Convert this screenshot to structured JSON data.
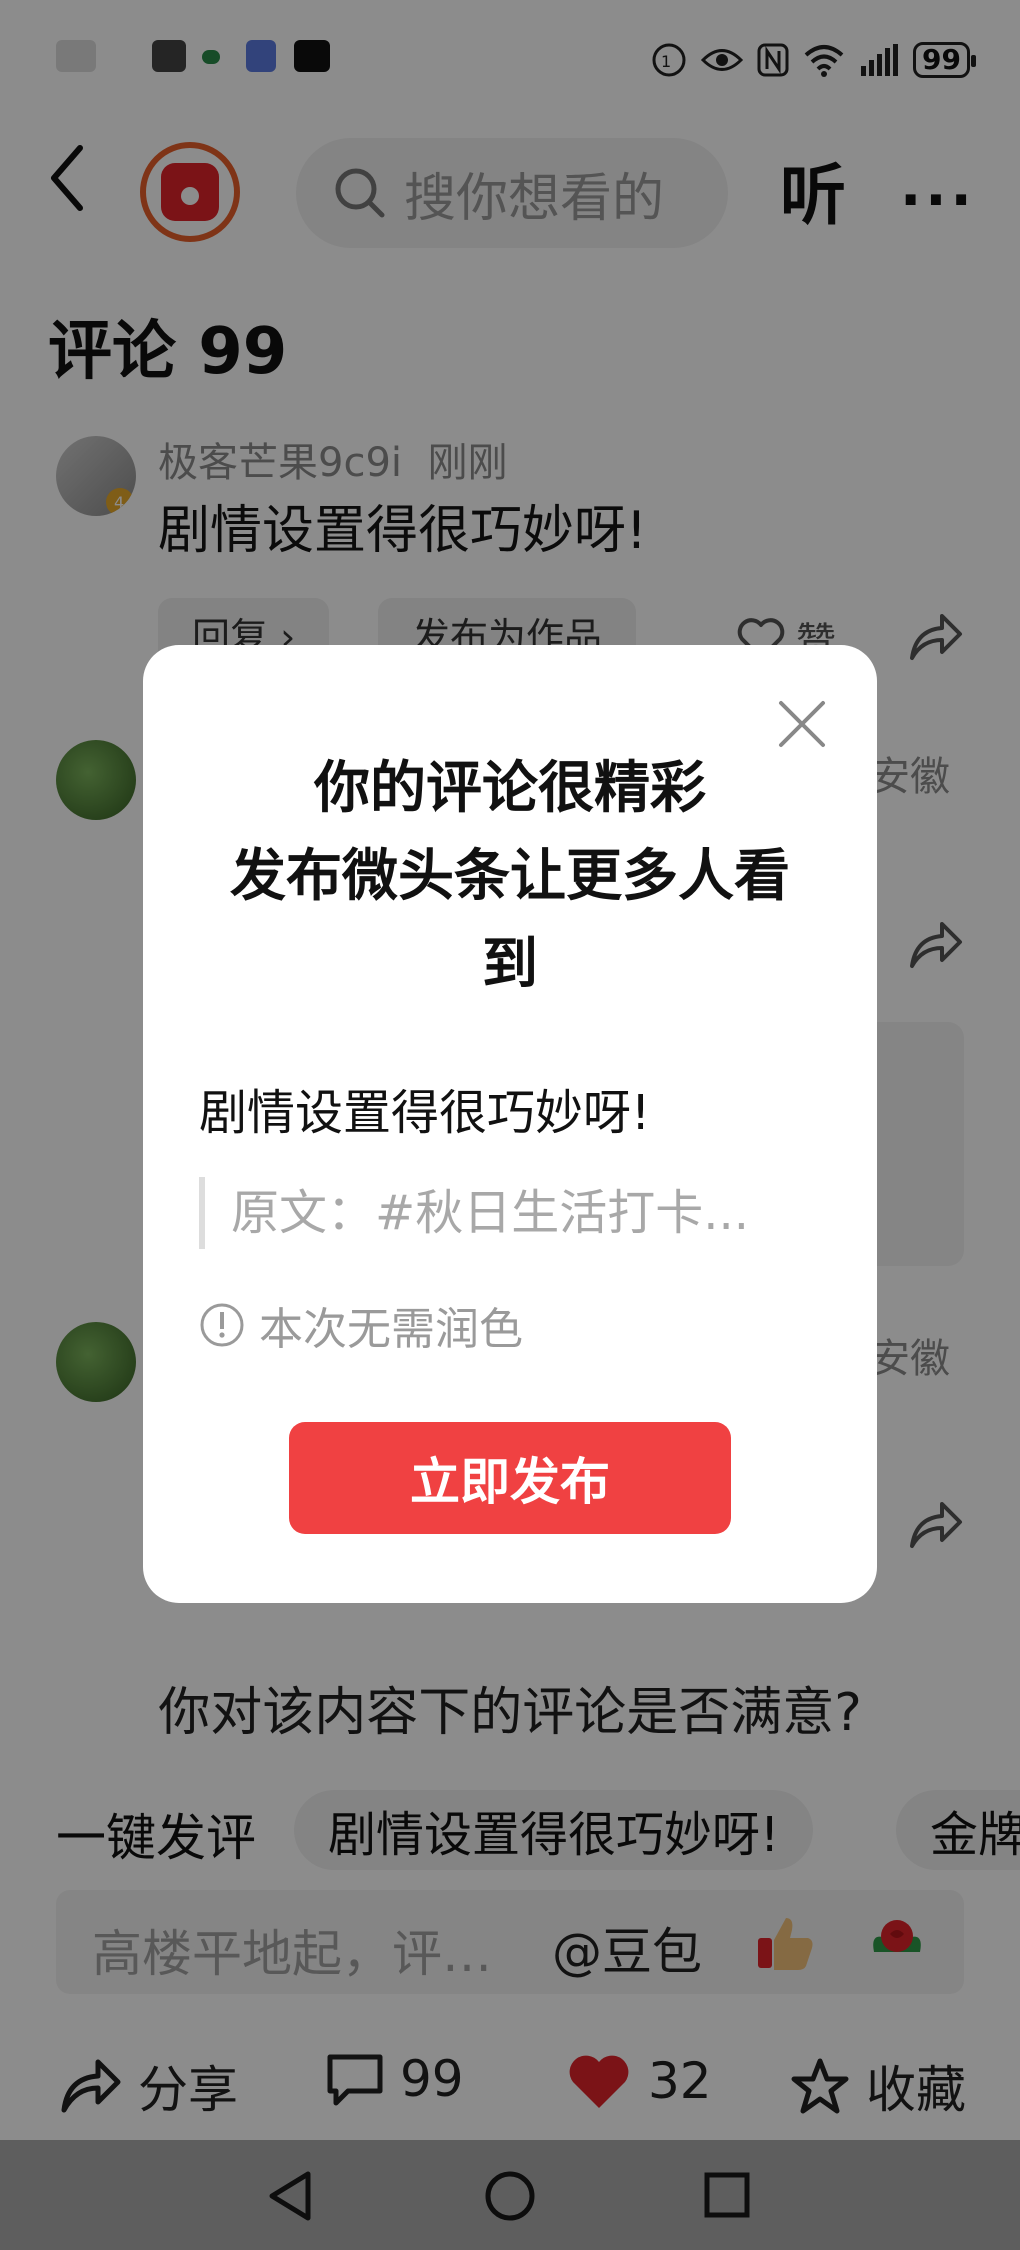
{
  "status_bar": {
    "battery": "99"
  },
  "header": {
    "search_placeholder": "搜你想看的",
    "listen_label": "听",
    "more_label": "···"
  },
  "comments": {
    "title": "评论 99",
    "items": [
      {
        "user": "极客芒果9c9i",
        "time": "刚刚",
        "text": "剧情设置得很巧妙呀!",
        "reply_label": "回复 ›",
        "publish_label": "发布为作品",
        "like_label": "赞"
      },
      {
        "location": "安徽"
      },
      {
        "location": "安徽"
      }
    ]
  },
  "feedback": {
    "question": "你对该内容下的评论是否满意?"
  },
  "quick_comment": {
    "label": "一键发评",
    "chips": [
      "剧情设置得很巧妙呀!",
      "金牌"
    ]
  },
  "input_bar": {
    "placeholder": "高楼平地起，评…",
    "mention": "@豆包"
  },
  "actions": {
    "share": "分享",
    "comments": "99",
    "likes": "32",
    "favorite": "收藏"
  },
  "modal": {
    "title_line1": "你的评论很精彩",
    "title_line2": "发布微头条让更多人看",
    "title_line3": "到",
    "comment_text": "剧情设置得很巧妙呀!",
    "quote_text": "原文：#秋日生活打卡...",
    "hint": "本次无需润色",
    "publish_button": "立即发布"
  },
  "colors": {
    "accent_red": "#f04142",
    "like_red": "#e0242b",
    "logo_orange": "#e8602b"
  }
}
